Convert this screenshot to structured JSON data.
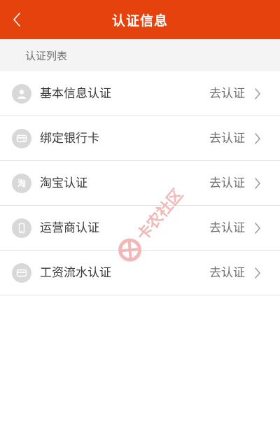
{
  "header": {
    "title": "认证信息",
    "back_icon": "chevron-left-icon"
  },
  "section": {
    "label": "认证列表"
  },
  "list": {
    "items": [
      {
        "label": "基本信息认证",
        "action": "去认证",
        "icon": "person-icon"
      },
      {
        "label": "绑定银行卡",
        "action": "去认证",
        "icon": "bank-card-icon"
      },
      {
        "label": "淘宝认证",
        "action": "去认证",
        "icon": "taobao-icon",
        "icon_text": "淘"
      },
      {
        "label": "运营商认证",
        "action": "去认证",
        "icon": "mobile-phone-icon"
      },
      {
        "label": "工资流水认证",
        "action": "去认证",
        "icon": "card-icon"
      }
    ]
  },
  "watermark": {
    "text": "卡农社区"
  },
  "colors": {
    "header_bg": "#e4430e",
    "section_bg": "#f4f4f4",
    "icon_bg": "#d8d8d8",
    "divider": "#e3e3e3",
    "watermark": "#f2b8b8"
  }
}
